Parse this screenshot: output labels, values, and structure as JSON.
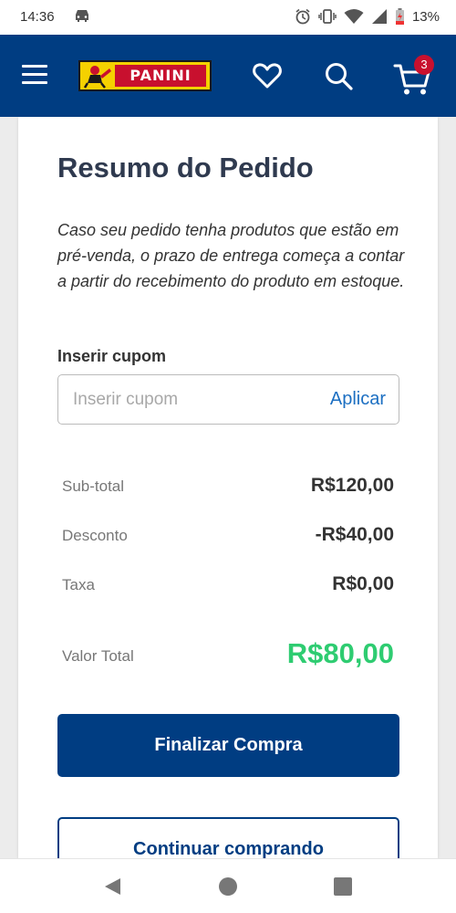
{
  "status_bar": {
    "time": "14:36",
    "battery": "13%",
    "icons": [
      "car-icon",
      "alarm-icon",
      "vibrate-icon",
      "wifi-icon",
      "signal-icon",
      "battery-icon"
    ]
  },
  "header": {
    "logo_text": "PANINI",
    "cart_count": "3",
    "icons": [
      "menu-icon",
      "heart-icon",
      "search-icon",
      "cart-icon"
    ],
    "colors": {
      "brand_blue": "#003d82",
      "logo_yellow": "#f5d100",
      "logo_red": "#c8102e"
    }
  },
  "order_summary": {
    "title": "Resumo do Pedido",
    "notice": "Caso seu pedido tenha produtos que estão em pré-venda, o prazo de entrega começa a contar a partir do recebimento do produto em estoque.",
    "coupon": {
      "label": "Inserir cupom",
      "placeholder": "Inserir cupom",
      "value": "",
      "apply_label": "Aplicar"
    },
    "rows": [
      {
        "label": "Sub-total",
        "value": "R$120,00"
      },
      {
        "label": "Desconto",
        "value": "-R$40,00"
      },
      {
        "label": "Taxa",
        "value": "R$0,00"
      }
    ],
    "total": {
      "label": "Valor Total",
      "value": "R$80,00",
      "color": "#2ecc71"
    },
    "finalize_label": "Finalizar Compra",
    "continue_label": "Continuar comprando"
  },
  "nav_bar": {
    "icons": [
      "back-icon",
      "home-icon",
      "recents-icon"
    ]
  }
}
